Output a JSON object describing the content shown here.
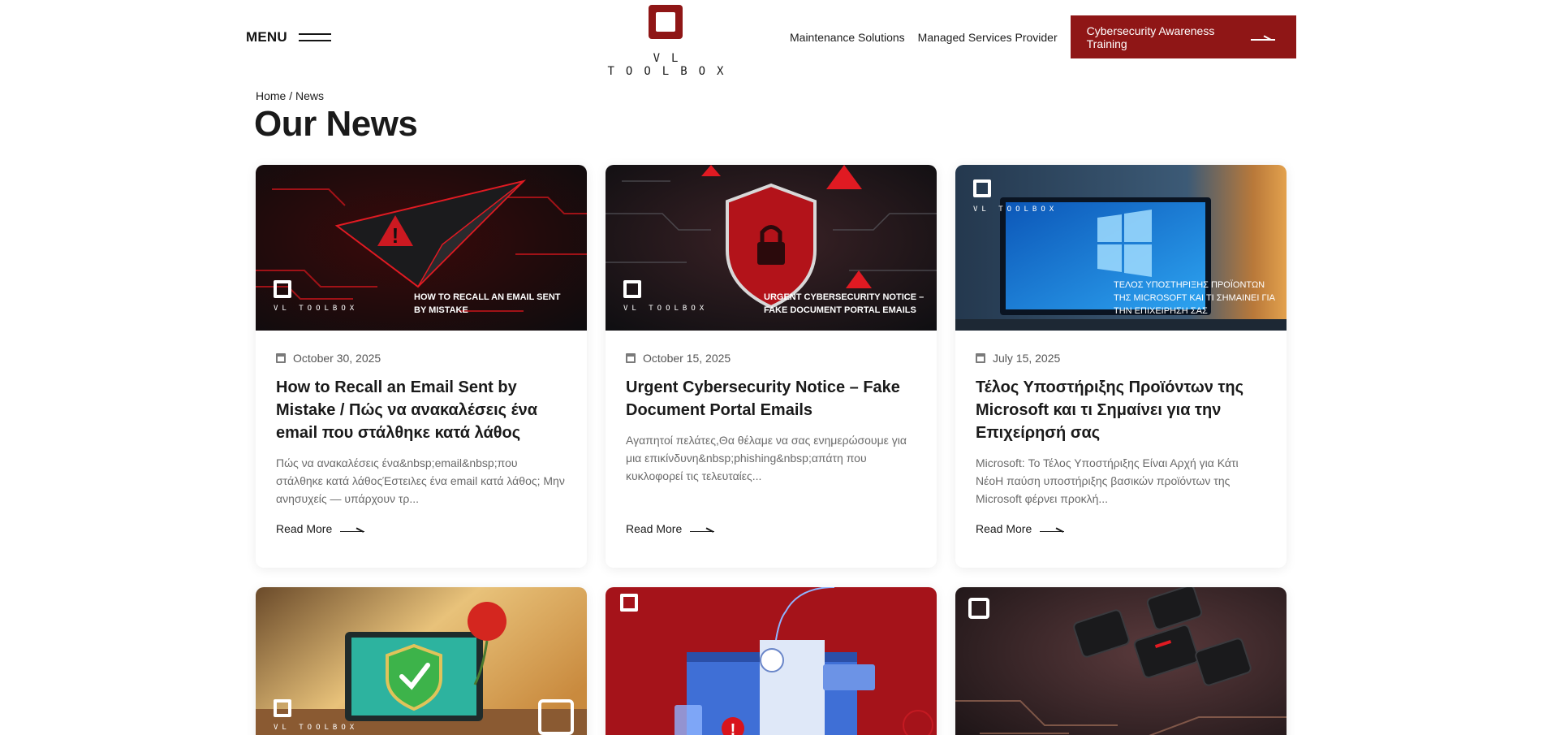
{
  "header": {
    "menu_label": "MENU",
    "logo_text": "VL TOOLBOX",
    "nav": [
      {
        "label": "Maintenance Solutions"
      },
      {
        "label": "Managed Services Provider"
      }
    ],
    "cta_label": "Cybersecurity Awareness Training"
  },
  "colors": {
    "brand": "#8f1616",
    "text": "#1c1c1c",
    "muted": "#6a6a6a"
  },
  "breadcrumb": {
    "home": "Home",
    "separator": "/",
    "current": "News"
  },
  "page_title": "Our News",
  "brand_label": "VL TOOLBOX",
  "cards": [
    {
      "date": "October 30, 2025",
      "title": "How to Recall an Email Sent by Mistake / Πώς να ανακαλέσεις ένα email που στάλθηκε κατά λάθος",
      "excerpt": "Πώς να ανακαλέσεις ένα&nbsp;email&nbsp;που στάλθηκε κατά λάθοςΈστειλες ένα email κατά λάθος; Μην ανησυχείς — υπάρχουν τρ...",
      "read_more": "Read More",
      "image_caption": "HOW TO RECALL AN EMAIL SENT BY MISTAKE",
      "image_icon": "paper-plane-icon"
    },
    {
      "date": "October 15, 2025",
      "title": "Urgent Cybersecurity Notice – Fake Document Portal Emails",
      "excerpt": "Αγαπητοί πελάτες,Θα θέλαμε να σας ενημερώσουμε για μια επικίνδυνη&nbsp;phishing&nbsp;απάτη που κυκλοφορεί τις τελευταίες...",
      "read_more": "Read More",
      "image_caption": "URGENT CYBERSECURITY NOTICE – FAKE DOCUMENT PORTAL EMAILS",
      "image_icon": "shield-lock-icon"
    },
    {
      "date": "July 15, 2025",
      "title": "Τέλος Υποστήριξης Προϊόντων της Microsoft και τι Σημαίνει για την Επιχείρησή σας",
      "excerpt": "Microsoft: Το Τέλος Υποστήριξης Είναι Αρχή για Κάτι ΝέοΗ παύση υποστήριξης βασικών προϊόντων της Microsoft φέρνει προκλή...",
      "read_more": "Read More",
      "image_caption": "ΤΕΛΟΣ ΥΠΟΣΤΗΡΙΞΗΣ ΠΡΟΪΟΝΤΩΝ ΤΗΣ MICROSOFT ΚΑΙ ΤΙ ΣΗΜΑΙΝΕΙ ΓΙΑ ΤΗΝ ΕΠΙΧΕΙΡΗΣΗ ΣΑΣ",
      "image_icon": "monitor-icon"
    },
    {
      "image_icon": "laptop-shield-icon"
    },
    {
      "image_icon": "phishing-envelope-icon"
    },
    {
      "image_icon": "delete-key-icon"
    }
  ]
}
